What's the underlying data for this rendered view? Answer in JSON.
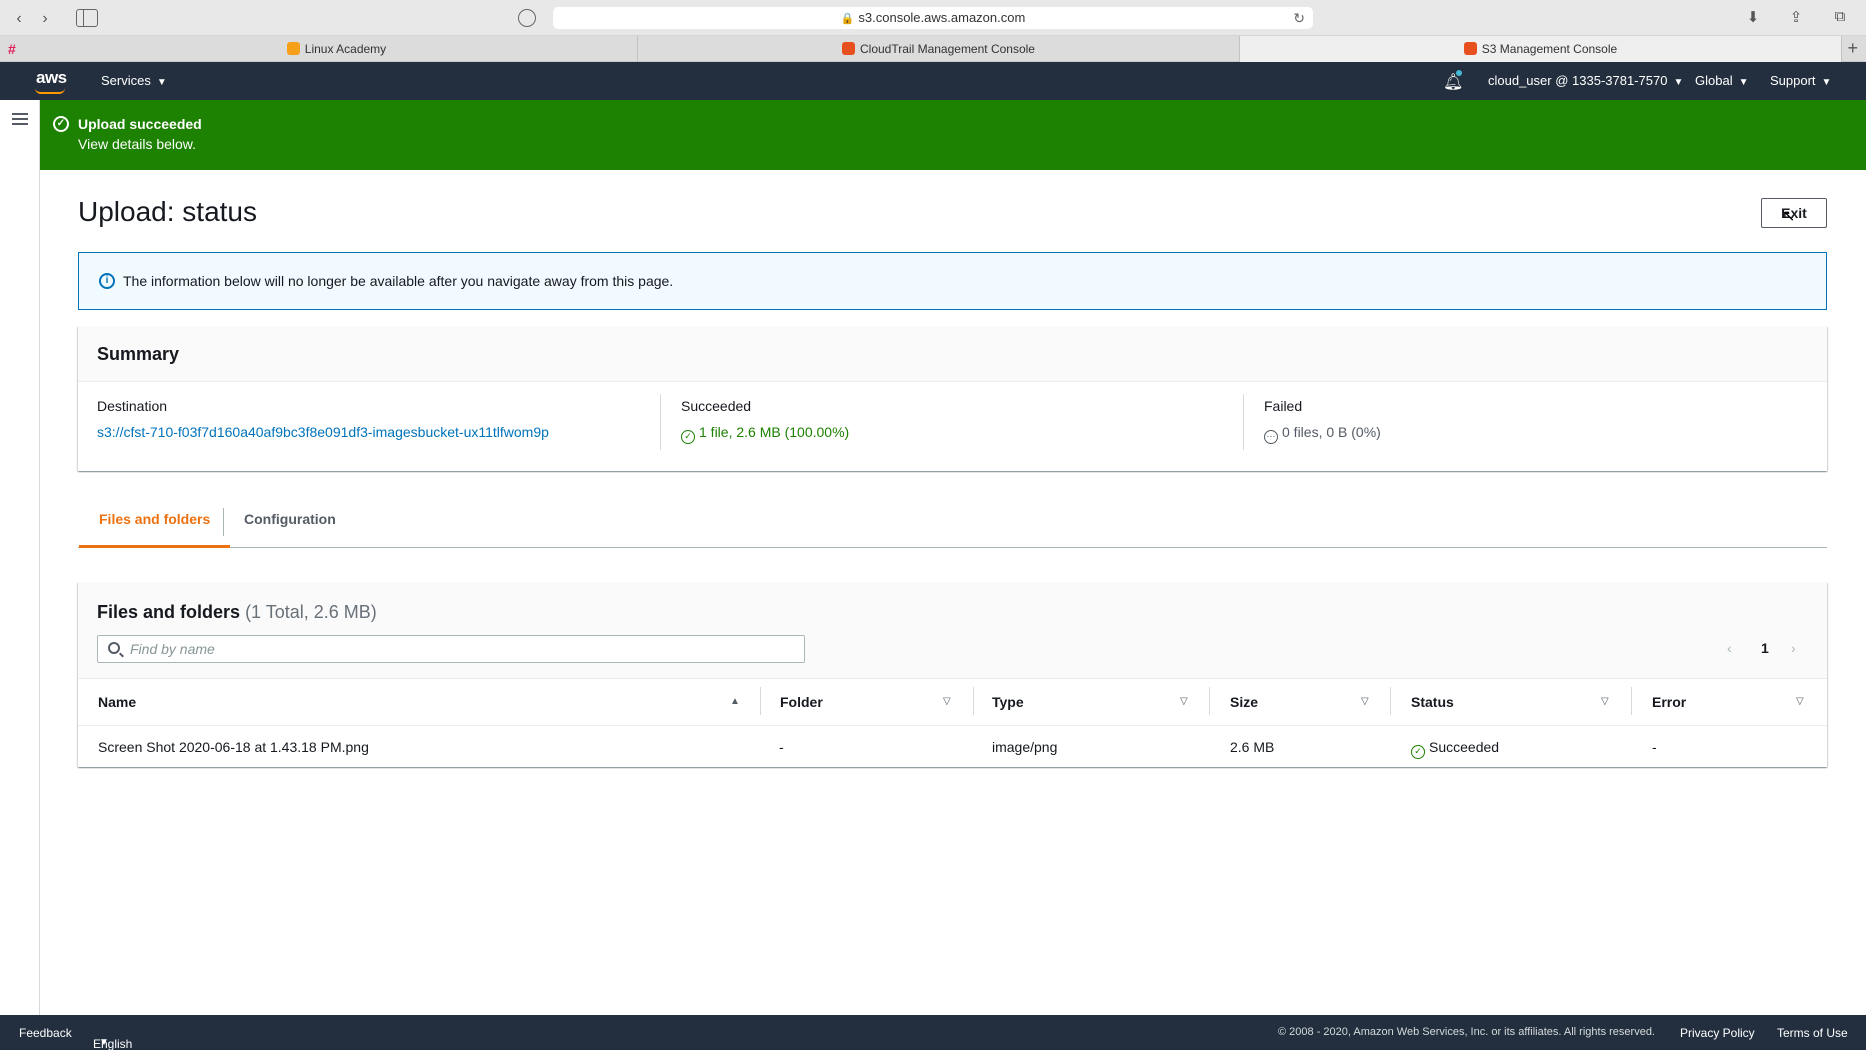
{
  "browser": {
    "url": "s3.console.aws.amazon.com",
    "tabs": [
      {
        "title": "Linux Academy",
        "favicon_color": "#f6a01a"
      },
      {
        "title": "CloudTrail Management Console",
        "favicon_color": "#e7501e"
      },
      {
        "title": "S3 Management Console",
        "favicon_color": "#e7501e"
      }
    ]
  },
  "header": {
    "logo": "aws",
    "services": "Services",
    "account": "cloud_user @ 1335-3781-7570",
    "region": "Global",
    "support": "Support"
  },
  "flash": {
    "title": "Upload succeeded",
    "subtitle": "View details below.",
    "color": "#1d8102"
  },
  "page": {
    "title": "Upload: status",
    "exit_label": "Exit"
  },
  "info": {
    "text": "The information below will no longer be available after you navigate away from this page."
  },
  "summary": {
    "title": "Summary",
    "destination_label": "Destination",
    "destination_value": "s3://cfst-710-f03f7d160a40af9bc3f8e091df3-imagesbucket-ux11tlfwom9p",
    "succeeded_label": "Succeeded",
    "succeeded_value": "1 file, 2.6 MB (100.00%)",
    "failed_label": "Failed",
    "failed_value": "0 files, 0 B (0%)"
  },
  "tabs": {
    "files": "Files and folders",
    "config": "Configuration"
  },
  "files": {
    "title": "Files and folders",
    "count": "(1 Total, 2.6 MB)",
    "search_placeholder": "Find by name",
    "page": "1",
    "columns": [
      "Name",
      "Folder",
      "Type",
      "Size",
      "Status",
      "Error"
    ],
    "rows": [
      {
        "name": "Screen Shot 2020-06-18 at 1.43.18 PM.png",
        "folder": "-",
        "type": "image/png",
        "size": "2.6 MB",
        "status": "Succeeded",
        "error": "-"
      }
    ]
  },
  "footer": {
    "feedback": "Feedback",
    "language": "English (US)",
    "copyright": "© 2008 - 2020, Amazon Web Services, Inc. or its affiliates. All rights reserved.",
    "privacy": "Privacy Policy",
    "terms": "Terms of Use"
  }
}
